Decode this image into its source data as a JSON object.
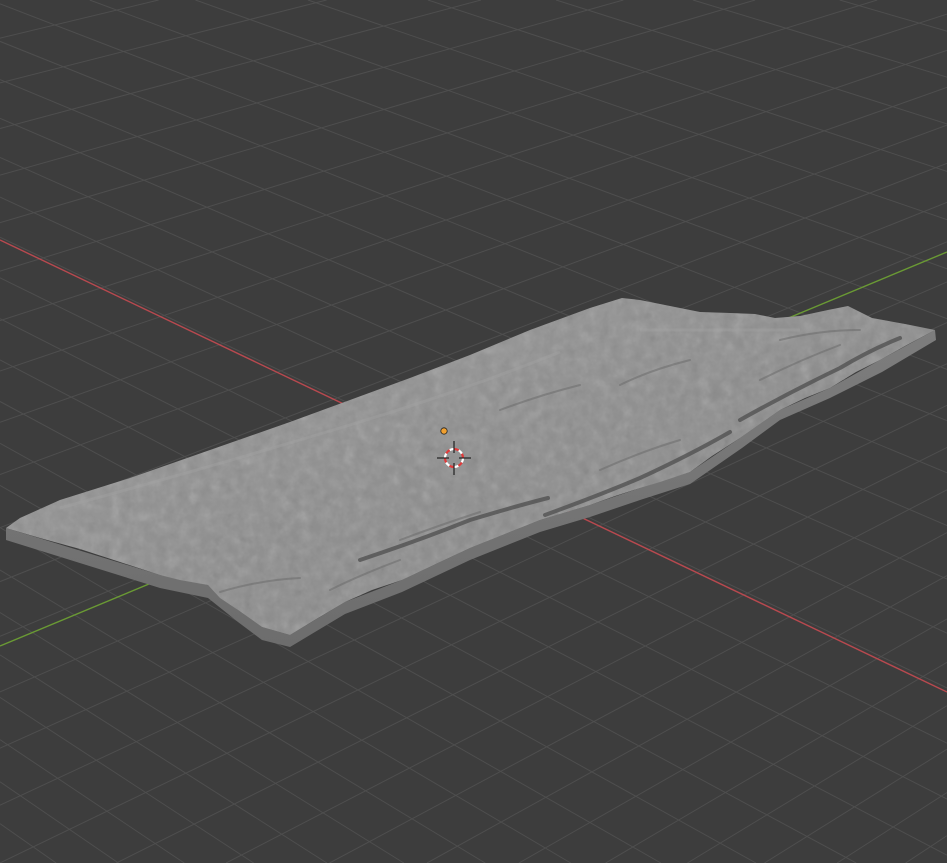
{
  "viewport": {
    "background_color": "#3d3d3d",
    "grid_color": "#4e4e4e",
    "x_axis_color": "#b8494f",
    "y_axis_color": "#6a9a34",
    "mesh_color": "#8f8f8f",
    "mesh_shadow_color": "#5d5d5d",
    "mesh_highlight_color": "#a5a5a5",
    "origin_color": "#f0a030",
    "cursor_colors": [
      "#e23a3a",
      "#ffffff"
    ]
  },
  "scene": {
    "object": "terrain-mesh",
    "icons": {
      "origin": "object-origin-dot",
      "cursor": "3d-cursor-icon"
    }
  }
}
